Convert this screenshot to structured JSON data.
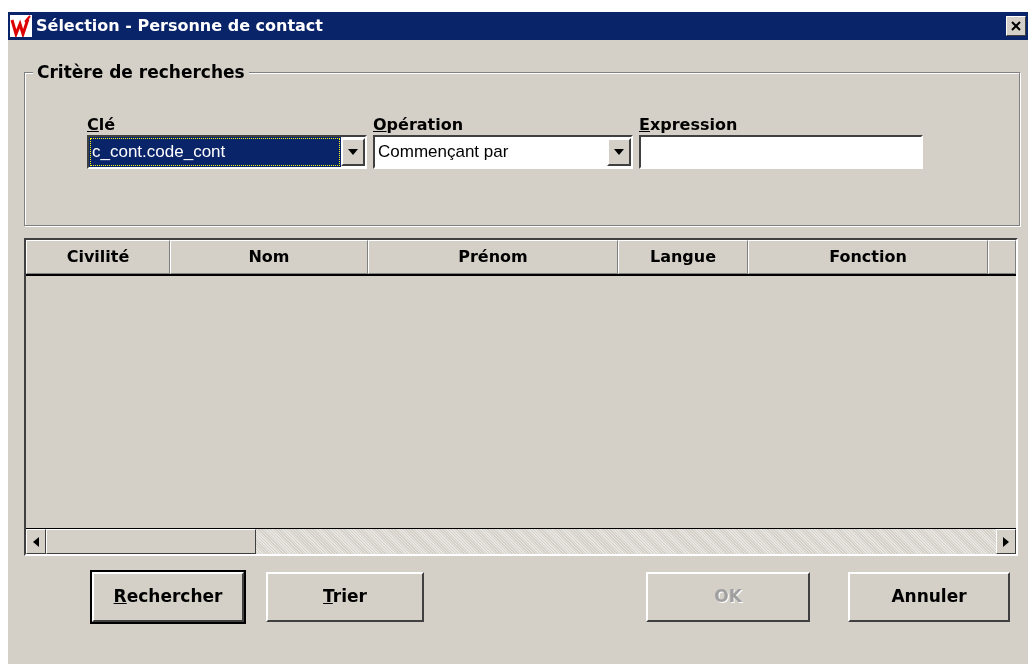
{
  "window": {
    "title": "Sélection - Personne de contact"
  },
  "search_criteria": {
    "title": "Critère de recherches",
    "fields": [
      {
        "kind": "combo",
        "label": "Clé",
        "mnemonic": true,
        "value": "c_cont.code_cont",
        "selected": true
      },
      {
        "kind": "combo",
        "label": "Opération",
        "mnemonic": true,
        "value": "Commençant par",
        "selected": false
      },
      {
        "kind": "text",
        "label": "Expression",
        "mnemonic": true,
        "selected": false
      }
    ]
  },
  "table": {
    "columns": [
      "Civilité",
      "Nom",
      "Prénom",
      "Langue",
      "Fonction"
    ]
  },
  "buttons": [
    {
      "label": "Rechercher",
      "mnemonic": true,
      "default": true,
      "disabled": false
    },
    {
      "label": "Trier",
      "mnemonic": true,
      "default": false,
      "disabled": false
    },
    {
      "label": "OK",
      "mnemonic": false,
      "default": false,
      "disabled": true
    },
    {
      "label": "Annuler",
      "mnemonic": false,
      "default": false,
      "disabled": false
    }
  ]
}
